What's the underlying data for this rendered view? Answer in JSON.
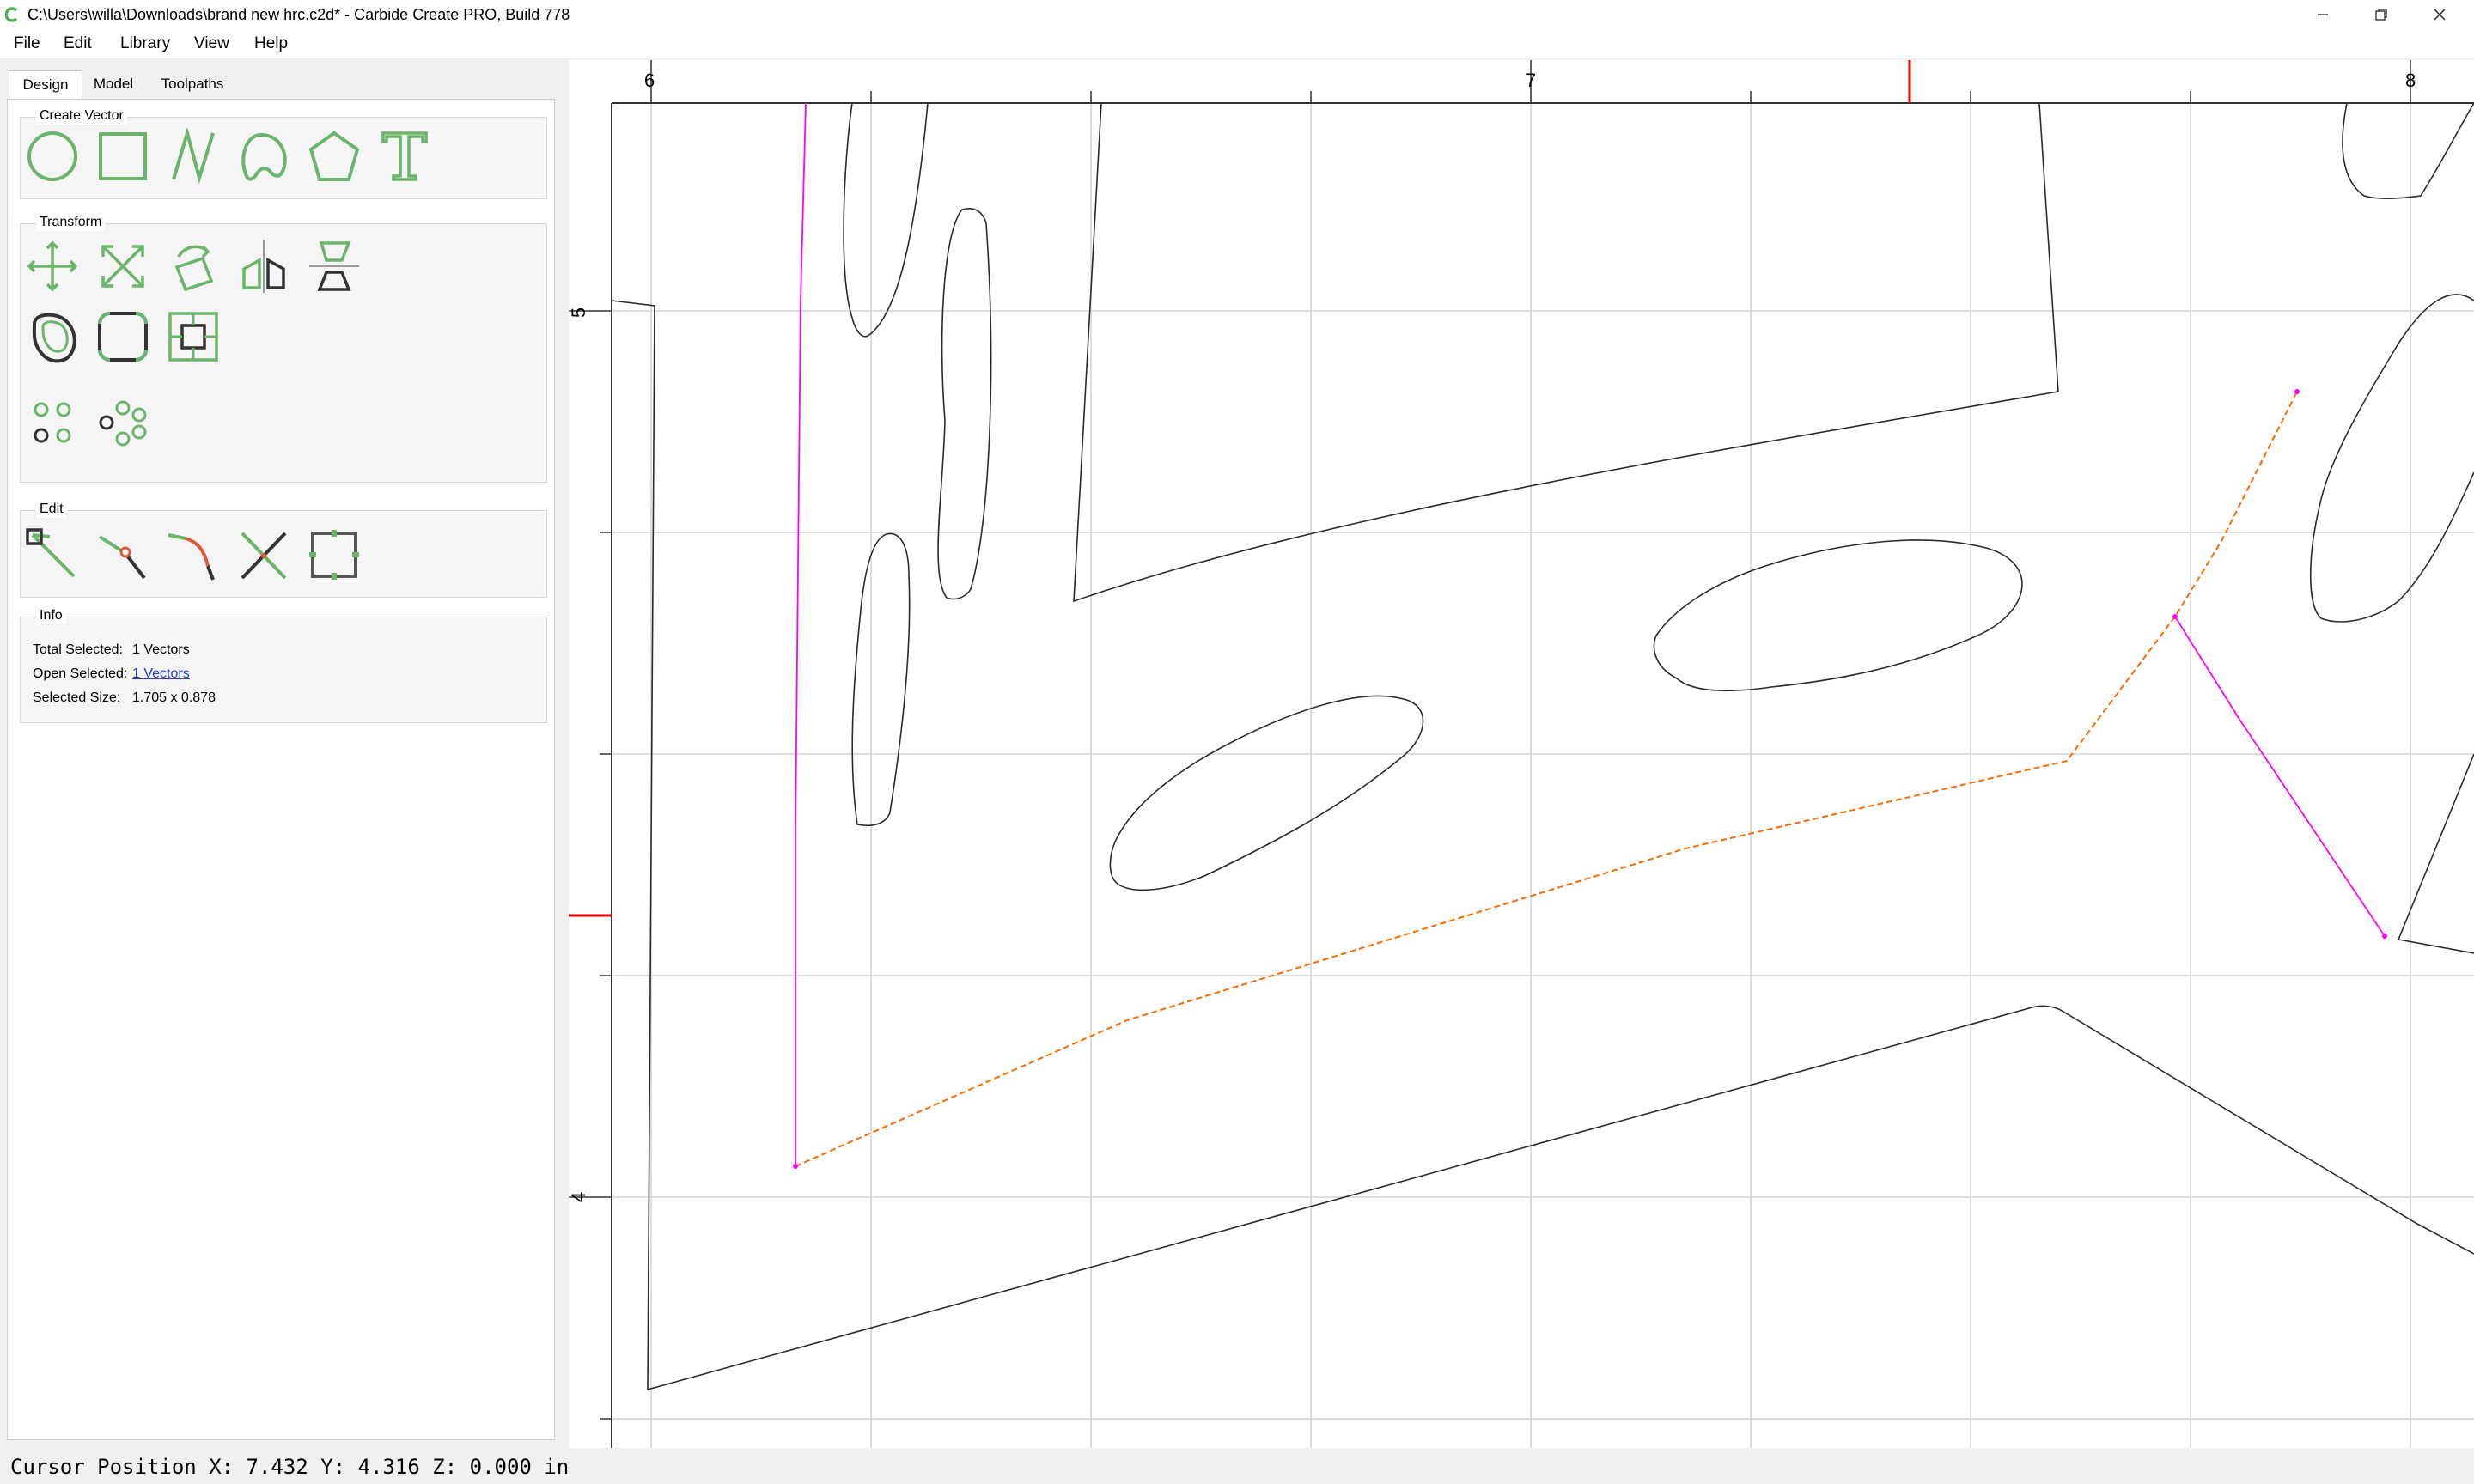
{
  "window": {
    "title": "C:\\Users\\willa\\Downloads\\brand new hrc.c2d* - Carbide Create PRO, Build 778",
    "minimize_icon": "minimize-icon",
    "restore_icon": "restore-icon",
    "close_icon": "close-icon"
  },
  "menu": {
    "file": "File",
    "edit": "Edit",
    "library": "Library",
    "view": "View",
    "help": "Help"
  },
  "tabs": {
    "design": "Design",
    "model": "Model",
    "toolpaths": "Toolpaths",
    "active": "Design"
  },
  "create_vector": {
    "label": "Create Vector",
    "tools": [
      "circle-tool-icon",
      "rectangle-tool-icon",
      "polyline-tool-icon",
      "curve-tool-icon",
      "polygon-tool-icon",
      "text-tool-icon"
    ]
  },
  "transform": {
    "label": "Transform",
    "tools": [
      "move-icon",
      "scale-icon",
      "rotate-icon",
      "mirror-icon",
      "align-icon",
      "offset-icon",
      "fillet-icon",
      "boundary-box-icon",
      "linear-array-icon",
      "circular-array-icon"
    ]
  },
  "edit_group": {
    "label": "Edit",
    "tools": [
      "node-edit-icon",
      "split-icon",
      "trim-icon",
      "cut-icon",
      "bounding-box-icon"
    ]
  },
  "info": {
    "label": "Info",
    "total_selected_label": "Total Selected:",
    "total_selected_value": "1 Vectors",
    "open_selected_label": "Open Selected:",
    "open_selected_value": "1 Vectors",
    "selected_size_label": "Selected Size:",
    "selected_size_value": "1.705 x 0.878"
  },
  "rulers": {
    "horizontal": [
      "6",
      "7",
      "8"
    ],
    "vertical": [
      "5",
      "4"
    ]
  },
  "colors": {
    "accent_green": "#6ab56a",
    "selection_orange": "#ff6a00",
    "open_path_magenta": "#ff00ff",
    "cursor_marker_red": "#e00000",
    "link_blue": "#1f3ddb"
  },
  "status": {
    "cursor_position": "Cursor Position X: 7.432 Y: 4.316 Z: 0.000 in"
  }
}
